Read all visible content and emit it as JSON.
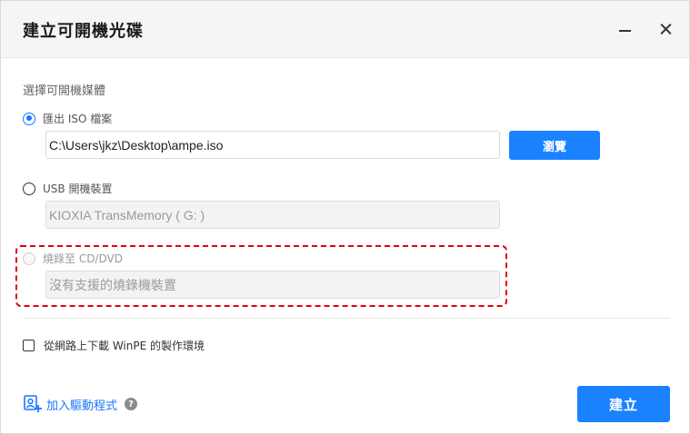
{
  "window": {
    "title": "建立可開機光碟",
    "minimize_icon": "minimize-icon",
    "close_icon": "close-icon"
  },
  "media": {
    "section_label": "選擇可開機媒體",
    "options": [
      {
        "label": "匯出 ISO 檔案",
        "selected": true,
        "field_value": "C:\\Users\\jkz\\Desktop\\ampe.iso",
        "button_label": "瀏覽"
      },
      {
        "label": "USB 開機裝置",
        "selected": false,
        "field_value": "KIOXIA  TransMemory     ( G: )"
      },
      {
        "label": "燒錄至 CD/DVD",
        "selected": false,
        "disabled": true,
        "field_placeholder": "沒有支援的燒錄機裝置"
      }
    ]
  },
  "winpe": {
    "checkbox_label": "從網路上下載 WinPE 的製作環境",
    "checked": false
  },
  "footer": {
    "add_driver_label": "加入驅動程式",
    "help_icon": "?",
    "create_button_label": "建立"
  },
  "colors": {
    "accent": "#1a82ff",
    "highlight": "#e0000f"
  }
}
